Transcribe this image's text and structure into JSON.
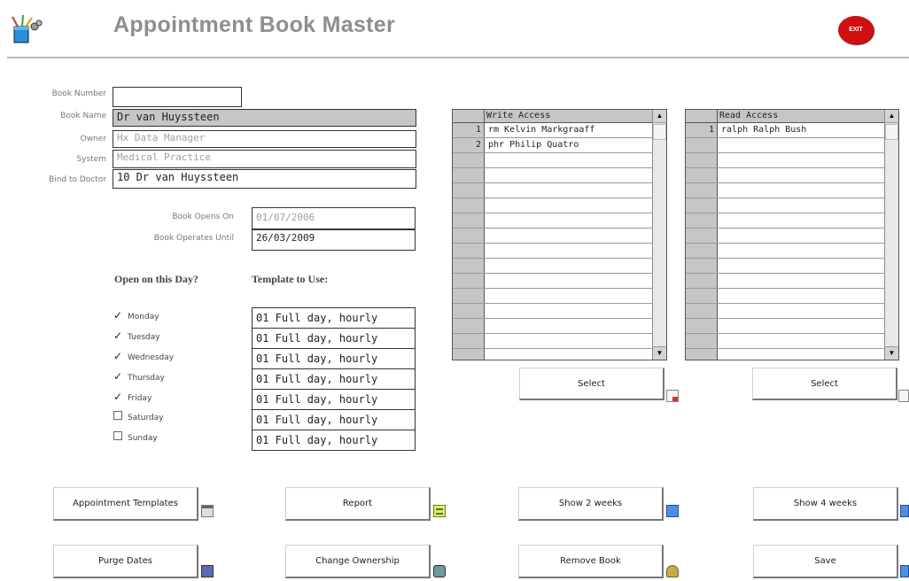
{
  "header": {
    "title": "Appointment Book Master",
    "exit_label": "EXIT"
  },
  "form": {
    "book_number": {
      "label": "Book Number",
      "value": ""
    },
    "book_name": {
      "label": "Book Name",
      "value": "Dr van Huyssteen"
    },
    "owner": {
      "label": "Owner",
      "value": "Hx Data Manager"
    },
    "system": {
      "label": "System",
      "value": "Medical Practice"
    },
    "bind_to_doctor": {
      "label": "Bind to Doctor",
      "value": "10 Dr van Huyssteen"
    },
    "opens_on": {
      "label": "Book Opens On",
      "value": "01/07/2006"
    },
    "operates_until": {
      "label": "Book Operates Until",
      "value": "26/03/2009"
    }
  },
  "schedule": {
    "open_heading": "Open on this Day?",
    "template_heading": "Template to Use:",
    "days": [
      {
        "name": "Monday",
        "checked": true,
        "template": "01 Full day, hourly"
      },
      {
        "name": "Tuesday",
        "checked": true,
        "template": "01 Full day, hourly"
      },
      {
        "name": "Wednesday",
        "checked": true,
        "template": "01 Full day, hourly"
      },
      {
        "name": "Thursday",
        "checked": true,
        "template": "01 Full day, hourly"
      },
      {
        "name": "Friday",
        "checked": true,
        "template": "01 Full day, hourly"
      },
      {
        "name": "Saturday",
        "checked": false,
        "template": "01 Full day, hourly"
      },
      {
        "name": "Sunday",
        "checked": false,
        "template": "01 Full day, hourly"
      }
    ]
  },
  "write_access": {
    "header": "Write Access",
    "rows": [
      {
        "num": "1",
        "value": "rm Kelvin Markgraaff"
      },
      {
        "num": "2",
        "value": "phr Philip Quatro"
      }
    ],
    "select_label": "Select"
  },
  "read_access": {
    "header": "Read Access",
    "rows": [
      {
        "num": "1",
        "value": "ralph Ralph Bush"
      }
    ],
    "select_label": "Select"
  },
  "buttons": {
    "appointment_templates": "Appointment Templates",
    "report": "Report",
    "show_2_weeks": "Show 2 weeks",
    "show_4_weeks": "Show 4 weeks",
    "purge_dates": "Purge Dates",
    "change_ownership": "Change Ownership",
    "remove_book": "Remove Book",
    "save": "Save"
  },
  "colors": {
    "title_gray": "#8e8e8e",
    "exit_red": "#d01010",
    "grid_gray": "#c6c6c6"
  }
}
